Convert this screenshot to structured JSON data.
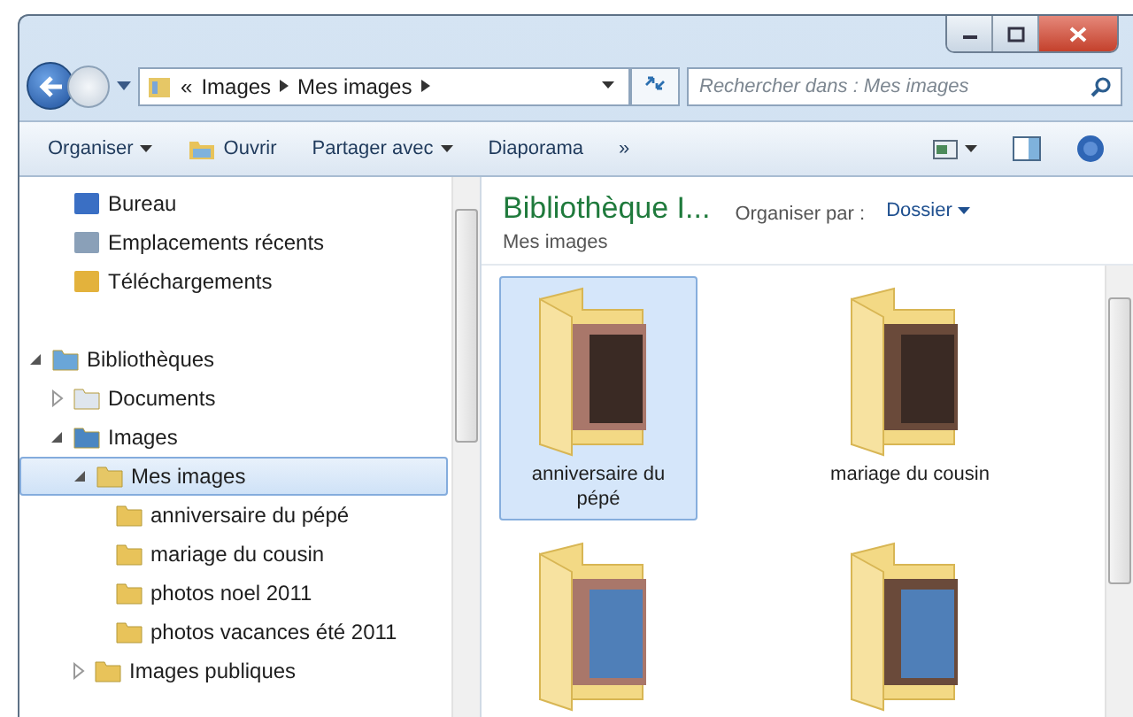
{
  "address": {
    "overflow": "«",
    "crumbs": [
      "Images",
      "Mes images"
    ]
  },
  "search": {
    "placeholder": "Rechercher dans : Mes images"
  },
  "toolbar": {
    "items": [
      {
        "label": "Organiser",
        "kind": "menu"
      },
      {
        "label": "Ouvrir",
        "kind": "icon-button"
      },
      {
        "label": "Partager avec",
        "kind": "menu"
      },
      {
        "label": "Diaporama",
        "kind": "plain"
      }
    ],
    "more": "»"
  },
  "favorites": [
    {
      "label": "Bureau",
      "kind": "desktop",
      "selected": false
    },
    {
      "label": "Emplacements récents",
      "kind": "recent",
      "selected": false
    },
    {
      "label": "Téléchargements",
      "kind": "downloads",
      "selected": false
    }
  ],
  "libraries": [
    {
      "label": "Bibliothèques",
      "kind": "library",
      "selected": false,
      "expanded": true,
      "children": [
        {
          "label": "Documents",
          "kind": "documents",
          "selected": false,
          "expanded": false
        },
        {
          "label": "Images",
          "kind": "images",
          "selected": false,
          "expanded": true,
          "children": [
            {
              "label": "Mes images",
              "kind": "library-folder",
              "selected": true,
              "expanded": true,
              "children": [
                {
                  "label": "anniversaire du pépé",
                  "kind": "folder",
                  "selected": false
                },
                {
                  "label": "mariage du cousin",
                  "kind": "folder",
                  "selected": false
                },
                {
                  "label": "photos noel 2011",
                  "kind": "folder",
                  "selected": false
                },
                {
                  "label": "photos vacances été 2011",
                  "kind": "folder",
                  "selected": false
                }
              ]
            },
            {
              "label": "Images publiques",
              "kind": "folder",
              "selected": false,
              "expanded": false
            }
          ]
        }
      ]
    }
  ],
  "library": {
    "title": "Bibliothèque I...",
    "subtitle": "Mes images",
    "arrange_label": "Organiser par :",
    "arrange_value": "Dossier"
  },
  "folders": [
    {
      "name": "anniversaire du pépé",
      "selected": true
    },
    {
      "name": "mariage du cousin",
      "selected": false
    },
    {
      "selected": false
    },
    {
      "selected": false
    }
  ]
}
